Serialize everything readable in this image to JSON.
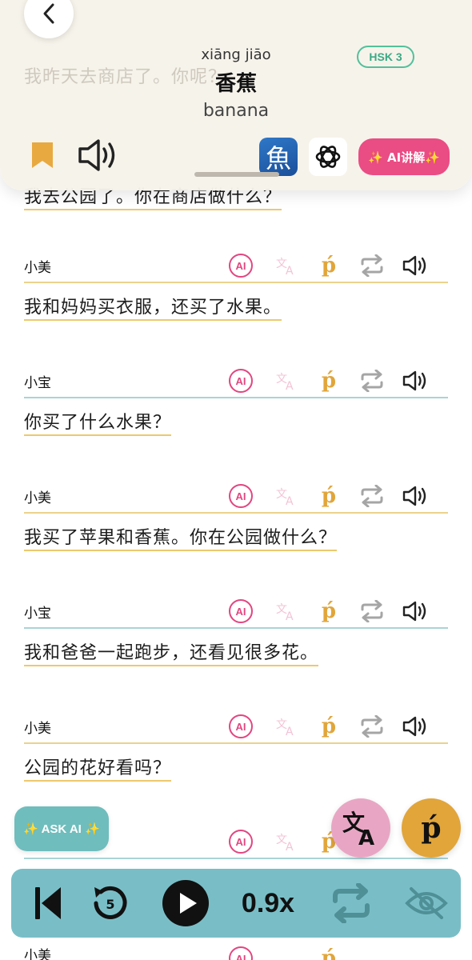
{
  "word_card": {
    "ghost_text": "我昨天去商店了。你呢？",
    "pinyin": "xiāng jiāo",
    "hanzi": "香蕉",
    "meaning": "banana",
    "hsk_badge": "HSK 3",
    "ai_explain_label": "✨ AI讲解✨",
    "dict_app_glyph": "魚",
    "colors": {
      "bookmark": "#e8a940",
      "ai_pink": "#ea4c84",
      "hsk_green": "#52c09b"
    }
  },
  "partial_line": "我去公园了。你在商店做什么？",
  "tool_labels": {
    "ai": "AI",
    "pinyin": "ṕ"
  },
  "dialogue": [
    {
      "speaker": "小美",
      "text": "我和妈妈买衣服，还买了水果。",
      "rule": "gold"
    },
    {
      "speaker": "小宝",
      "text": "你买了什么水果？",
      "rule": "teal"
    },
    {
      "speaker": "小美",
      "text": "我买了苹果和香蕉。你在公园做什么？",
      "rule": "gold"
    },
    {
      "speaker": "小宝",
      "text": "我和爸爸一起跑步，还看见很多花。",
      "rule": "teal"
    },
    {
      "speaker": "小美",
      "text": "公园的花好看吗？",
      "rule": "gold"
    },
    {
      "speaker": "小美",
      "text": "",
      "rule": "teal"
    }
  ],
  "ask_ai_label": "✨ ASK AI ✨",
  "player": {
    "rewind_seconds": "5",
    "speed": "0.9x",
    "colors": {
      "bar": "#79bec7"
    }
  }
}
